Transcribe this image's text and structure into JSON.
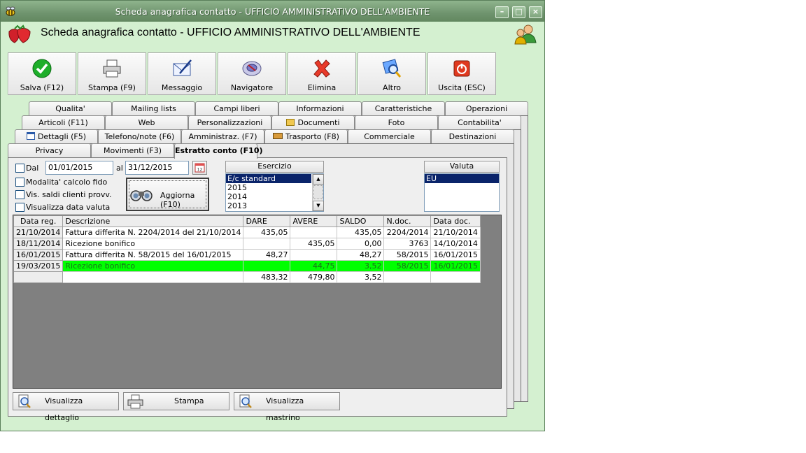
{
  "window": {
    "title": "Scheda anagrafica contatto - UFFICIO AMMINISTRATIVO DELL'AMBIENTE",
    "buttons": [
      "minimize-icon",
      "maximize-icon",
      "close-icon"
    ]
  },
  "header": {
    "title": "Scheda anagrafica contatto - UFFICIO AMMINISTRATIVO DELL'AMBIENTE"
  },
  "toolbar": [
    {
      "label": "Salva (F12)",
      "icon": "check-icon"
    },
    {
      "label": "Stampa (F9)",
      "icon": "printer-icon"
    },
    {
      "label": "Messaggio",
      "icon": "envelope-icon"
    },
    {
      "label": "Navigatore",
      "icon": "compass-icon"
    },
    {
      "label": "Elimina",
      "icon": "delete-x-icon"
    },
    {
      "label": "Altro",
      "icon": "magnifier-icon"
    },
    {
      "label": "Uscita (ESC)",
      "icon": "exit-icon"
    }
  ],
  "tabs": {
    "row1": [
      "Qualita'",
      "Mailing lists",
      "Campi liberi",
      "Informazioni",
      "Caratteristiche",
      "Operazioni"
    ],
    "row2": [
      "Articoli (F11)",
      "Web",
      "Personalizzazioni",
      "Documenti",
      "Foto",
      "Contabilita'"
    ],
    "row3": [
      "Dettagli (F5)",
      "Telefono/note (F6)",
      "Amministraz. (F7)",
      "Trasporto (F8)",
      "Commerciale",
      "Destinazioni"
    ],
    "row4": [
      "Privacy",
      "Movimenti (F3)",
      "Estratto conto (F10)"
    ],
    "active": "Estratto conto (F10)"
  },
  "filters": {
    "dal_label": "Dal",
    "dal_checked": false,
    "date_from": "01/01/2015",
    "al_label": "al",
    "date_to": "31/12/2015",
    "checkboxes": [
      {
        "label": "Modalita' calcolo fido",
        "checked": false
      },
      {
        "label": "Vis. saldi clienti provv.",
        "checked": false
      },
      {
        "label": "Visualizza data valuta",
        "checked": false
      }
    ],
    "refresh_label": "Aggiorna (F10)"
  },
  "esercizio": {
    "header": "Esercizio",
    "items": [
      "E/c standard",
      "2015",
      "2014",
      "2013"
    ],
    "selected": "E/c standard"
  },
  "valuta": {
    "header": "Valuta",
    "items": [
      "EU"
    ],
    "selected": "EU"
  },
  "grid": {
    "columns": [
      "Data reg.",
      "Descrizione",
      "DARE",
      "AVERE",
      "SALDO",
      "N.doc.",
      "Data doc."
    ],
    "rows": [
      [
        "21/10/2014",
        "Fattura differita N. 2204/2014 del 21/10/2014",
        "435,05",
        "",
        "435,05",
        "2204/2014",
        "21/10/2014"
      ],
      [
        "18/11/2014",
        "Ricezione bonifico",
        "",
        "435,05",
        "0,00",
        "3763",
        "14/10/2014"
      ],
      [
        "16/01/2015",
        "Fattura differita N. 58/2015 del 16/01/2015",
        "48,27",
        "",
        "48,27",
        "58/2015",
        "16/01/2015"
      ],
      [
        "19/03/2015",
        "Ricezione bonifico",
        "",
        "44,75",
        "3,52",
        "58/2015",
        "16/01/2015"
      ]
    ],
    "highlighted_row": 3,
    "highlight_color": "#00ff00",
    "totals": [
      "",
      "",
      "483,32",
      "479,80",
      "3,52",
      "",
      ""
    ]
  },
  "bottom_buttons": [
    {
      "label": "Visualizza dettaglio",
      "icon": "zoom-document-icon"
    },
    {
      "label": "Stampa",
      "icon": "printer-icon"
    },
    {
      "label": "Visualizza mastrino",
      "icon": "zoom-document-icon"
    }
  ],
  "colors": {
    "window_bg": "#d4f0d0",
    "titlebar": "#6f946e",
    "selection": "#0a246a"
  }
}
